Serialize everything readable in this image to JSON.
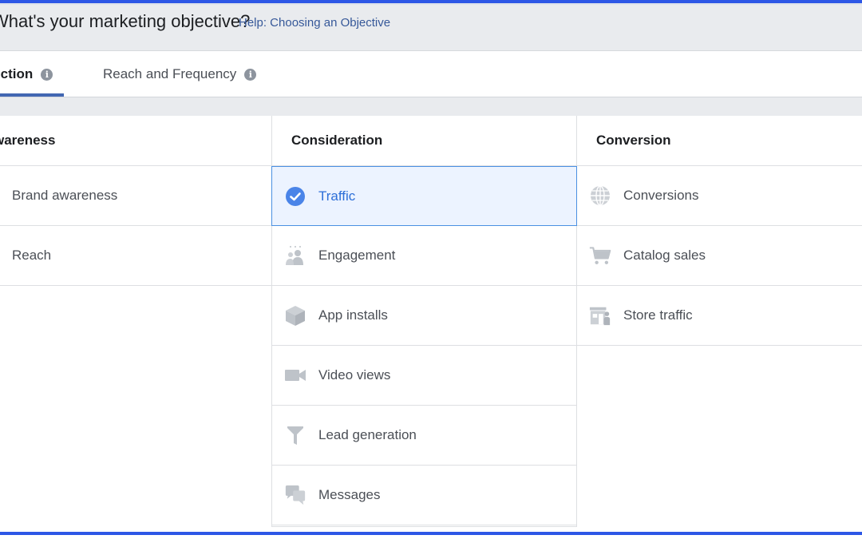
{
  "header": {
    "title": "What's your marketing objective?",
    "help_link": "Help: Choosing an Objective"
  },
  "tabs": [
    {
      "label": "Auction",
      "active": true
    },
    {
      "label": "Reach and Frequency",
      "active": false
    }
  ],
  "columns": {
    "awareness": {
      "title": "Awareness",
      "items": [
        {
          "label": "Brand awareness",
          "icon": "megaphone-icon"
        },
        {
          "label": "Reach",
          "icon": "reach-icon"
        }
      ]
    },
    "consideration": {
      "title": "Consideration",
      "items": [
        {
          "label": "Traffic",
          "icon": "check-circle-icon",
          "selected": true
        },
        {
          "label": "Engagement",
          "icon": "people-icon"
        },
        {
          "label": "App installs",
          "icon": "box-icon"
        },
        {
          "label": "Video views",
          "icon": "video-camera-icon"
        },
        {
          "label": "Lead generation",
          "icon": "funnel-icon"
        },
        {
          "label": "Messages",
          "icon": "chat-bubbles-icon"
        }
      ]
    },
    "conversion": {
      "title": "Conversion",
      "items": [
        {
          "label": "Conversions",
          "icon": "globe-icon"
        },
        {
          "label": "Catalog sales",
          "icon": "shopping-cart-icon"
        },
        {
          "label": "Store traffic",
          "icon": "store-icon"
        }
      ]
    }
  },
  "colors": {
    "accent": "#4267b2",
    "selected_text": "#2d6fd8",
    "selected_bg": "#ecf3ff",
    "frame": "#2d57e6",
    "icon_gray": "#bec3c9"
  }
}
